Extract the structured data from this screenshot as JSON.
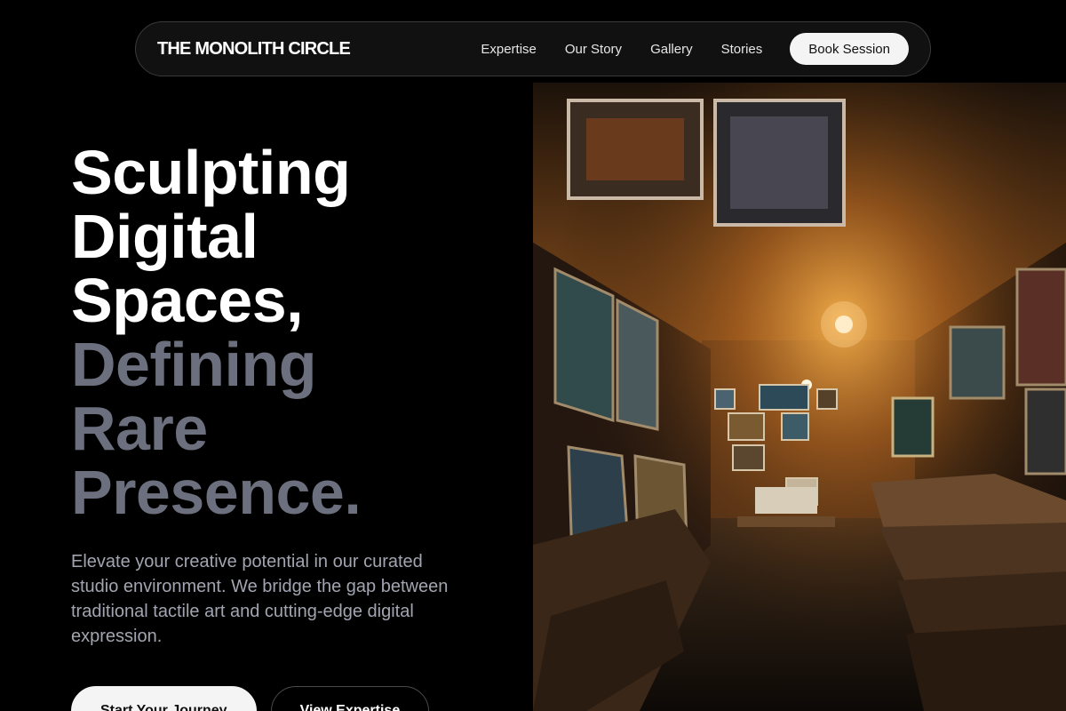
{
  "nav": {
    "brand": "THE MONOLITH CIRCLE",
    "links": [
      "Expertise",
      "Our Story",
      "Gallery",
      "Stories"
    ],
    "book_label": "Book Session"
  },
  "hero": {
    "headline_primary": [
      "Sculpting",
      "Digital",
      "Spaces,"
    ],
    "headline_secondary": [
      "Defining",
      "Rare",
      "Presence."
    ],
    "lead": "Elevate your creative potential in our curated studio environment. We bridge the gap between traditional tactile art and cutting-edge digital expression.",
    "cta_primary": "Start Your Journey",
    "cta_secondary": "View Expertise"
  },
  "colors": {
    "background": "#000000",
    "headline_primary": "#ffffff",
    "headline_secondary": "#6c6f7d",
    "lead": "#a2a5b1",
    "button_light": "#f4f4f4"
  }
}
